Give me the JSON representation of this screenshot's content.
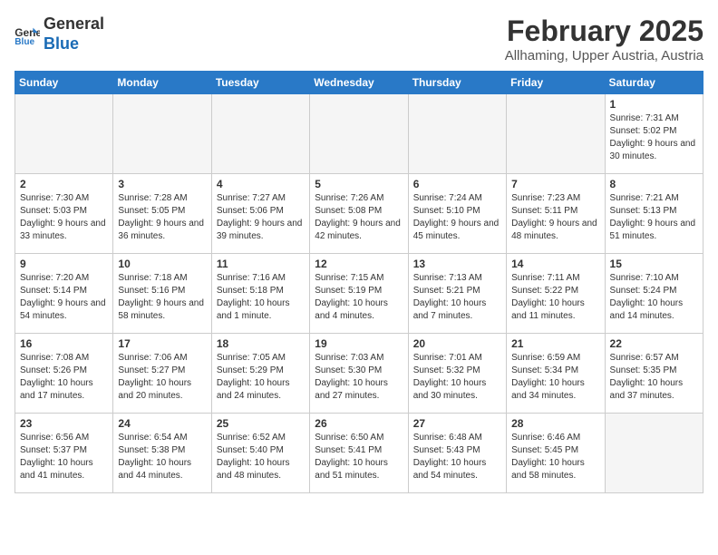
{
  "header": {
    "logo_line1": "General",
    "logo_line2": "Blue",
    "month": "February 2025",
    "location": "Allhaming, Upper Austria, Austria"
  },
  "weekdays": [
    "Sunday",
    "Monday",
    "Tuesday",
    "Wednesday",
    "Thursday",
    "Friday",
    "Saturday"
  ],
  "weeks": [
    [
      {
        "day": "",
        "info": ""
      },
      {
        "day": "",
        "info": ""
      },
      {
        "day": "",
        "info": ""
      },
      {
        "day": "",
        "info": ""
      },
      {
        "day": "",
        "info": ""
      },
      {
        "day": "",
        "info": ""
      },
      {
        "day": "1",
        "info": "Sunrise: 7:31 AM\nSunset: 5:02 PM\nDaylight: 9 hours and 30 minutes."
      }
    ],
    [
      {
        "day": "2",
        "info": "Sunrise: 7:30 AM\nSunset: 5:03 PM\nDaylight: 9 hours and 33 minutes."
      },
      {
        "day": "3",
        "info": "Sunrise: 7:28 AM\nSunset: 5:05 PM\nDaylight: 9 hours and 36 minutes."
      },
      {
        "day": "4",
        "info": "Sunrise: 7:27 AM\nSunset: 5:06 PM\nDaylight: 9 hours and 39 minutes."
      },
      {
        "day": "5",
        "info": "Sunrise: 7:26 AM\nSunset: 5:08 PM\nDaylight: 9 hours and 42 minutes."
      },
      {
        "day": "6",
        "info": "Sunrise: 7:24 AM\nSunset: 5:10 PM\nDaylight: 9 hours and 45 minutes."
      },
      {
        "day": "7",
        "info": "Sunrise: 7:23 AM\nSunset: 5:11 PM\nDaylight: 9 hours and 48 minutes."
      },
      {
        "day": "8",
        "info": "Sunrise: 7:21 AM\nSunset: 5:13 PM\nDaylight: 9 hours and 51 minutes."
      }
    ],
    [
      {
        "day": "9",
        "info": "Sunrise: 7:20 AM\nSunset: 5:14 PM\nDaylight: 9 hours and 54 minutes."
      },
      {
        "day": "10",
        "info": "Sunrise: 7:18 AM\nSunset: 5:16 PM\nDaylight: 9 hours and 58 minutes."
      },
      {
        "day": "11",
        "info": "Sunrise: 7:16 AM\nSunset: 5:18 PM\nDaylight: 10 hours and 1 minute."
      },
      {
        "day": "12",
        "info": "Sunrise: 7:15 AM\nSunset: 5:19 PM\nDaylight: 10 hours and 4 minutes."
      },
      {
        "day": "13",
        "info": "Sunrise: 7:13 AM\nSunset: 5:21 PM\nDaylight: 10 hours and 7 minutes."
      },
      {
        "day": "14",
        "info": "Sunrise: 7:11 AM\nSunset: 5:22 PM\nDaylight: 10 hours and 11 minutes."
      },
      {
        "day": "15",
        "info": "Sunrise: 7:10 AM\nSunset: 5:24 PM\nDaylight: 10 hours and 14 minutes."
      }
    ],
    [
      {
        "day": "16",
        "info": "Sunrise: 7:08 AM\nSunset: 5:26 PM\nDaylight: 10 hours and 17 minutes."
      },
      {
        "day": "17",
        "info": "Sunrise: 7:06 AM\nSunset: 5:27 PM\nDaylight: 10 hours and 20 minutes."
      },
      {
        "day": "18",
        "info": "Sunrise: 7:05 AM\nSunset: 5:29 PM\nDaylight: 10 hours and 24 minutes."
      },
      {
        "day": "19",
        "info": "Sunrise: 7:03 AM\nSunset: 5:30 PM\nDaylight: 10 hours and 27 minutes."
      },
      {
        "day": "20",
        "info": "Sunrise: 7:01 AM\nSunset: 5:32 PM\nDaylight: 10 hours and 30 minutes."
      },
      {
        "day": "21",
        "info": "Sunrise: 6:59 AM\nSunset: 5:34 PM\nDaylight: 10 hours and 34 minutes."
      },
      {
        "day": "22",
        "info": "Sunrise: 6:57 AM\nSunset: 5:35 PM\nDaylight: 10 hours and 37 minutes."
      }
    ],
    [
      {
        "day": "23",
        "info": "Sunrise: 6:56 AM\nSunset: 5:37 PM\nDaylight: 10 hours and 41 minutes."
      },
      {
        "day": "24",
        "info": "Sunrise: 6:54 AM\nSunset: 5:38 PM\nDaylight: 10 hours and 44 minutes."
      },
      {
        "day": "25",
        "info": "Sunrise: 6:52 AM\nSunset: 5:40 PM\nDaylight: 10 hours and 48 minutes."
      },
      {
        "day": "26",
        "info": "Sunrise: 6:50 AM\nSunset: 5:41 PM\nDaylight: 10 hours and 51 minutes."
      },
      {
        "day": "27",
        "info": "Sunrise: 6:48 AM\nSunset: 5:43 PM\nDaylight: 10 hours and 54 minutes."
      },
      {
        "day": "28",
        "info": "Sunrise: 6:46 AM\nSunset: 5:45 PM\nDaylight: 10 hours and 58 minutes."
      },
      {
        "day": "",
        "info": ""
      }
    ]
  ]
}
